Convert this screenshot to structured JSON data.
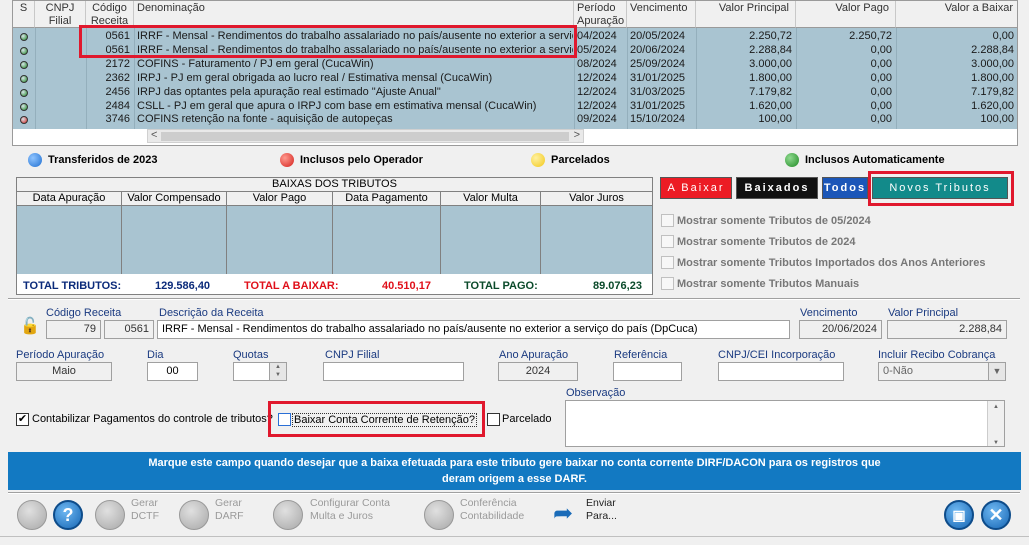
{
  "grid": {
    "headers": {
      "s": "S",
      "cnpj": "CNPJ",
      "cnpj_sub": "Filial",
      "codigo": "Código",
      "codigo_sub": "Receita",
      "denominacao": "Denominação",
      "periodo": "Período",
      "periodo_sub": "Apuração",
      "vencimento": "Vencimento",
      "valor_principal": "Valor Principal",
      "valor_pago": "Valor Pago",
      "valor_baixar": "Valor a Baixar"
    },
    "rows": [
      {
        "status": "green",
        "codigo": "0561",
        "denominacao": "IRRF - Mensal - Rendimentos do trabalho assalariado no país/ausente no exterior a serviço",
        "periodo": "04/2024",
        "vencimento": "20/05/2024",
        "valor_principal": "2.250,72",
        "valor_pago": "2.250,72",
        "valor_baixar": "0,00"
      },
      {
        "status": "green",
        "codigo": "0561",
        "denominacao": "IRRF - Mensal - Rendimentos do trabalho assalariado no país/ausente no exterior a serviço",
        "periodo": "05/2024",
        "vencimento": "20/06/2024",
        "valor_principal": "2.288,84",
        "valor_pago": "0,00",
        "valor_baixar": "2.288,84"
      },
      {
        "status": "green",
        "codigo": "2172",
        "denominacao": "COFINS - Faturamento / PJ em geral (CucaWin)",
        "periodo": "08/2024",
        "vencimento": "25/09/2024",
        "valor_principal": "3.000,00",
        "valor_pago": "0,00",
        "valor_baixar": "3.000,00"
      },
      {
        "status": "green",
        "codigo": "2362",
        "denominacao": "IRPJ - PJ em geral obrigada ao lucro real / Estimativa mensal (CucaWin)",
        "periodo": "12/2024",
        "vencimento": "31/01/2025",
        "valor_principal": "1.800,00",
        "valor_pago": "0,00",
        "valor_baixar": "1.800,00"
      },
      {
        "status": "green",
        "codigo": "2456",
        "denominacao": "IRPJ das optantes pela apuração real estimado \"Ajuste Anual\"",
        "periodo": "12/2024",
        "vencimento": "31/03/2025",
        "valor_principal": "7.179,82",
        "valor_pago": "0,00",
        "valor_baixar": "7.179,82"
      },
      {
        "status": "green",
        "codigo": "2484",
        "denominacao": "CSLL - PJ em geral que apura o IRPJ com base em estimativa mensal (CucaWin)",
        "periodo": "12/2024",
        "vencimento": "31/01/2025",
        "valor_principal": "1.620,00",
        "valor_pago": "0,00",
        "valor_baixar": "1.620,00"
      },
      {
        "status": "red",
        "codigo": "3746",
        "denominacao": "COFINS retenção na fonte - aquisição de autopeças",
        "periodo": "09/2024",
        "vencimento": "15/10/2024",
        "valor_principal": "100,00",
        "valor_pago": "0,00",
        "valor_baixar": "100,00"
      }
    ]
  },
  "legend": {
    "transferidos": "Transferidos de 2023",
    "inclusos_operador": "Inclusos pelo Operador",
    "parcelados": "Parcelados",
    "inclusos_auto": "Inclusos Automaticamente",
    "colors": {
      "blue": "#1f6fd1",
      "red": "#d4201c",
      "yellow": "#f2c81a",
      "green": "#1f8a24"
    }
  },
  "baixas": {
    "title": "BAIXAS DOS TRIBUTOS",
    "columns": [
      "Data Apuração",
      "Valor Compensado",
      "Valor Pago",
      "Data Pagamento",
      "Valor Multa",
      "Valor Juros"
    ],
    "total_tributos_label": "TOTAL TRIBUTOS:",
    "total_tributos": "129.586,40",
    "total_baixar_label": "TOTAL A BAIXAR:",
    "total_baixar": "40.510,17",
    "total_pago_label": "TOTAL PAGO:",
    "total_pago": "89.076,23"
  },
  "tabs": {
    "a_baixar": "A Baixar",
    "baixados": "Baixados",
    "todos": "Todos",
    "novos_tributos": "Novos Tributos"
  },
  "filters": {
    "f1": "Mostrar somente Tributos de 05/2024",
    "f2": "Mostrar somente Tributos de 2024",
    "f3": "Mostrar somente Tributos Importados dos Anos Anteriores",
    "f4": "Mostrar somente Tributos Manuais"
  },
  "form": {
    "codigo_receita_label": "Código Receita",
    "codigo_receita_1": "79",
    "codigo_receita_2": "0561",
    "descricao_label": "Descrição da Receita",
    "descricao": "IRRF - Mensal - Rendimentos do trabalho assalariado no país/ausente no exterior a serviço do país (DpCuca)",
    "vencimento_label": "Vencimento",
    "vencimento": "20/06/2024",
    "valor_principal_label": "Valor Principal",
    "valor_principal": "2.288,84",
    "periodo_label": "Período Apuração",
    "periodo": "Maio",
    "dia_label": "Dia",
    "dia": "00",
    "quotas_label": "Quotas",
    "quotas": "",
    "cnpj_filial_label": "CNPJ Filial",
    "cnpj_filial": "",
    "ano_label": "Ano Apuração",
    "ano": "2024",
    "referencia_label": "Referência",
    "referencia": "",
    "cnpj_cei_label": "CNPJ/CEI Incorporação",
    "cnpj_cei": "",
    "incluir_recibo_label": "Incluir Recibo Cobrança",
    "incluir_recibo": "0-Não",
    "contabilizar_label": "Contabilizar Pagamentos do controle de tributos?",
    "baixar_conta_label": "Baixar Conta Corrente de Retenção?",
    "parcelado_label": "Parcelado",
    "observacao_label": "Observação",
    "observacao": ""
  },
  "info": {
    "line1": "Marque este campo quando desejar que a baixa efetuada para este tributo gere baixar no conta corrente DIRF/DACON para os registros que",
    "line2": "deram origem a esse DARF."
  },
  "toolbar": {
    "gerar_dctf_1": "Gerar",
    "gerar_dctf_2": "DCTF",
    "gerar_darf_1": "Gerar",
    "gerar_darf_2": "DARF",
    "configurar_1": "Configurar Conta",
    "configurar_2": "Multa  e  Juros",
    "conferencia_1": "Conferência",
    "conferencia_2": "Contabilidade",
    "enviar_1": "Enviar",
    "enviar_2": "Para..."
  }
}
